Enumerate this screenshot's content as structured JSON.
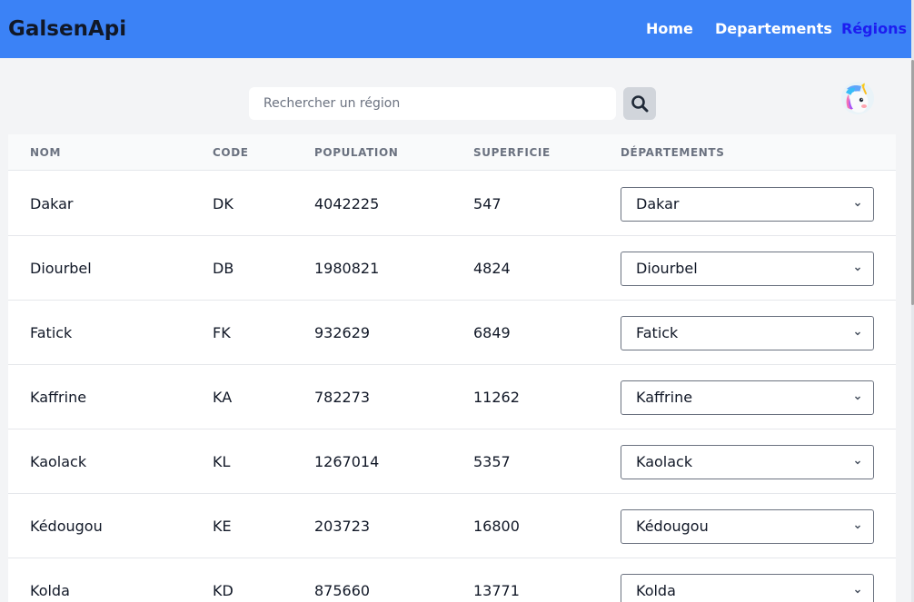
{
  "header": {
    "brand": "GalsenApi",
    "nav": [
      {
        "label": "Home",
        "active": false
      },
      {
        "label": "Departements",
        "active": false
      },
      {
        "label": "Régions",
        "active": true
      }
    ]
  },
  "search": {
    "placeholder": "Rechercher un région",
    "value": "",
    "button_icon": "search-icon"
  },
  "user": {
    "avatar_icon": "unicorn-avatar"
  },
  "table": {
    "columns": [
      "NOM",
      "CODE",
      "POPULATION",
      "SUPERFICIE",
      "DÉPARTEMENTS"
    ],
    "rows": [
      {
        "nom": "Dakar",
        "code": "DK",
        "population": "4042225",
        "superficie": "547",
        "departement": "Dakar"
      },
      {
        "nom": "Diourbel",
        "code": "DB",
        "population": "1980821",
        "superficie": "4824",
        "departement": "Diourbel"
      },
      {
        "nom": "Fatick",
        "code": "FK",
        "population": "932629",
        "superficie": "6849",
        "departement": "Fatick"
      },
      {
        "nom": "Kaffrine",
        "code": "KA",
        "population": "782273",
        "superficie": "11262",
        "departement": "Kaffrine"
      },
      {
        "nom": "Kaolack",
        "code": "KL",
        "population": "1267014",
        "superficie": "5357",
        "departement": "Kaolack"
      },
      {
        "nom": "Kédougou",
        "code": "KE",
        "population": "203723",
        "superficie": "16800",
        "departement": "Kédougou"
      },
      {
        "nom": "Kolda",
        "code": "KD",
        "population": "875660",
        "superficie": "13771",
        "departement": "Kolda"
      }
    ]
  },
  "colors": {
    "navbar": "#3b82f6",
    "nav_active": "#1d1df0",
    "page_background": "#f3f4f6"
  }
}
